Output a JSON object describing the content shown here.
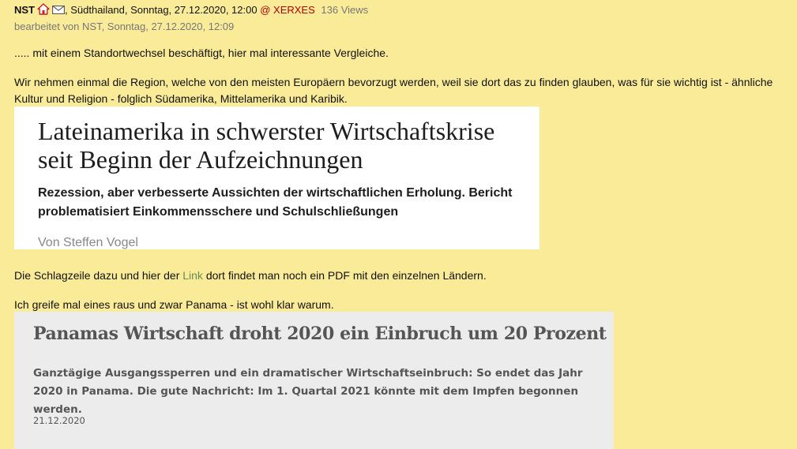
{
  "header": {
    "author": "NST",
    "location_date": ", Südthailand, Sonntag, 27.12.2020, 12:00",
    "recipient": "@ XERXES",
    "views": "136 Views"
  },
  "edited": "bearbeitet von NST, Sonntag, 27.12.2020, 12:09",
  "paragraph1": "..... mit einem Standortwechsel beschäftigt, hier mal interessante Vergleiche.",
  "paragraph2": "Wir nehmen einmal die Region, welche von den meisten Europäern bevorzugt werden, weil sie dort das zu finden glauben, was für sie wichtig ist - ähnliche Kultur und Religion - folglich Südamerika, Mittelamerika und Karibik.",
  "article1": {
    "title": "Lateinamerika in schwerster Wirtschaftskrise seit Beginn der Aufzeichnungen",
    "subtitle": "Rezession, aber verbesserte Aussichten der wirtschaftlichen Erholung. Bericht problematisiert Einkommensschere und Schulschließungen",
    "author": "Von Steffen Vogel"
  },
  "paragraph3": {
    "before": "Die Schlagzeile dazu und hier der ",
    "link": "Link",
    "after": " dort findet man noch ein PDF mit den einzelnen Ländern."
  },
  "paragraph4": "Ich greife mal eines raus und zwar Panama - ist wohl klar warum.",
  "article2": {
    "title": "Panamas Wirtschaft droht 2020 ein Einbruch um 20 Prozent",
    "subtitle": "Ganztägige Ausgangssperren und ein dramatischer Wirtschaftseinbruch: So endet das Jahr 2020 in Panama. Die gute Nachricht: Im 1. Quartal 2021 könnte mit dem Impfen begonnen werden.",
    "date": "21.12.2020"
  },
  "icons": [
    "home-icon",
    "mail-icon"
  ],
  "colors": {
    "background": "#faeb98",
    "recipient": "#b00000",
    "link": "#6a8a58"
  }
}
